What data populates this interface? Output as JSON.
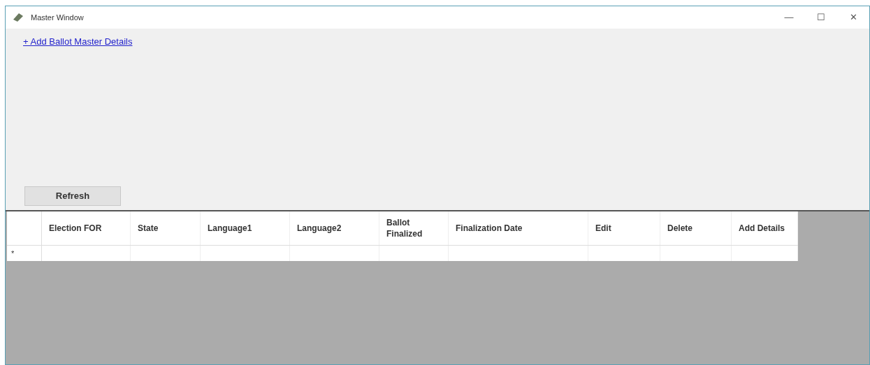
{
  "window": {
    "title": "Master Window",
    "controls": [
      "—",
      "☐",
      "✕"
    ]
  },
  "add_link": "+ Add Ballot Master Details",
  "refresh_button": "Refresh",
  "grid": {
    "columns": [
      {
        "label": "Election FOR"
      },
      {
        "label": "State"
      },
      {
        "label": "Language1"
      },
      {
        "label": "Language2"
      },
      {
        "label": "Ballot Finalized"
      },
      {
        "label": "Finalization Date"
      },
      {
        "label": "Edit"
      },
      {
        "label": "Delete"
      },
      {
        "label": "Add Details"
      }
    ],
    "new_row_marker": "*"
  }
}
